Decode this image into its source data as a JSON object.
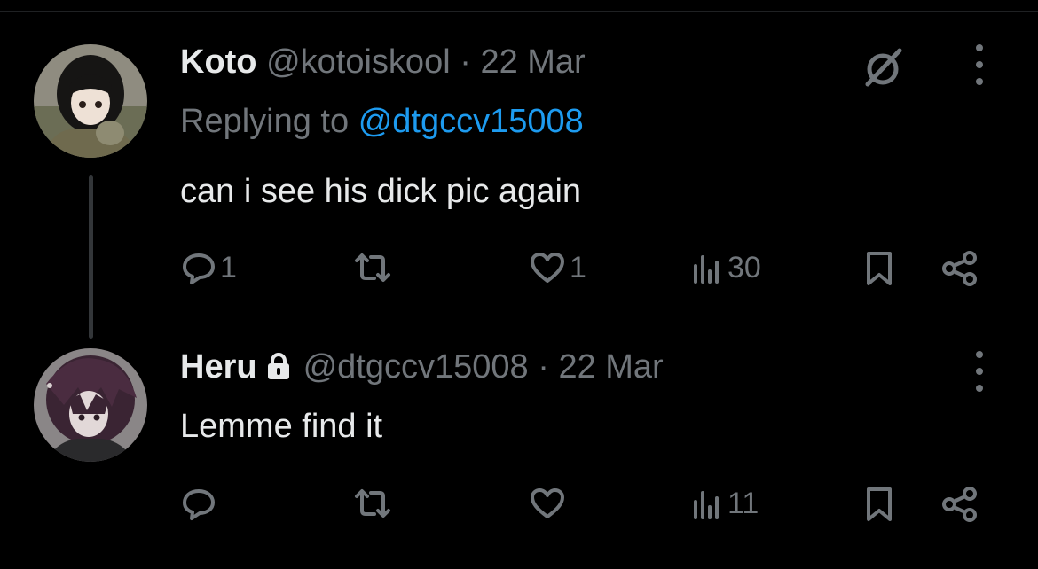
{
  "tweets": [
    {
      "display_name": "Koto",
      "handle": "@kotoiskool",
      "separator": "·",
      "date": "22 Mar",
      "replying_prefix": "Replying to",
      "replying_to": "@dtgccv15008",
      "text": "can i see his dick pic again",
      "reply_count": "1",
      "like_count": "1",
      "view_count": "30"
    },
    {
      "display_name": "Heru",
      "handle": "@dtgccv15008",
      "separator": "·",
      "date": "22 Mar",
      "text": "Lemme find it",
      "view_count": "11"
    }
  ],
  "icons": {
    "action_bar": [
      "reply-icon",
      "retweet-icon",
      "like-icon",
      "views-icon",
      "bookmark-icon",
      "share-icon"
    ],
    "grok": "grok-icon",
    "more": "more-icon",
    "protected": "lock-icon"
  },
  "colors": {
    "background": "#000000",
    "text_primary": "#e7e9ea",
    "text_secondary": "#71767b",
    "mention": "#1d9bf0"
  }
}
